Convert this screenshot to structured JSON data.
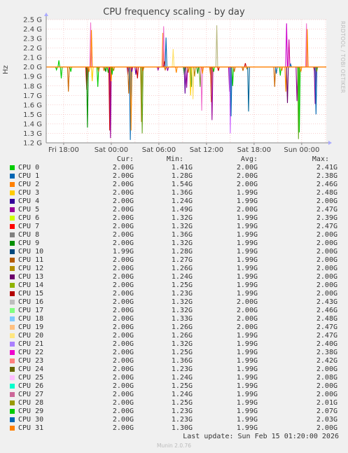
{
  "chart_data": {
    "type": "line",
    "title": "CPU frequency scaling - by day",
    "ylabel": "Hz",
    "ylim": [
      1.2,
      2.5
    ],
    "y_ticks": [
      "2.5 G",
      "2.4 G",
      "2.3 G",
      "2.2 G",
      "2.1 G",
      "2.0 G",
      "1.9 G",
      "1.8 G",
      "1.7 G",
      "1.6 G",
      "1.5 G",
      "1.4 G",
      "1.3 G",
      "1.2 G"
    ],
    "y_tick_values": [
      2.5,
      2.4,
      2.3,
      2.2,
      2.1,
      2.0,
      1.9,
      1.8,
      1.7,
      1.6,
      1.5,
      1.4,
      1.3,
      1.2
    ],
    "x_ticks": [
      "Fri 18:00",
      "Sat 00:00",
      "Sat 06:00",
      "Sat 12:00",
      "Sat 18:00",
      "Sun 00:00"
    ],
    "x_tick_hours": [
      0,
      6,
      12,
      18,
      24,
      30
    ],
    "x_range_hours": [
      -2.2,
      33.1
    ],
    "baseline": 2.0,
    "grid": true,
    "spikes": [
      {
        "t": -0.9,
        "v": 1.97,
        "c": "#00cc00"
      },
      {
        "t": -0.6,
        "v": 2.07,
        "c": "#00cc00"
      },
      {
        "t": -0.3,
        "v": 1.88,
        "c": "#00cc00"
      },
      {
        "t": 0.6,
        "v": 1.74,
        "c": "#cc6600"
      },
      {
        "t": 0.9,
        "v": 1.95,
        "c": "#00cc00"
      },
      {
        "t": 2.9,
        "v": 1.76,
        "c": "#cc0000"
      },
      {
        "t": 3.0,
        "v": 1.36,
        "c": "#008f00"
      },
      {
        "t": 3.2,
        "v": 1.95,
        "c": "#ff8800"
      },
      {
        "t": 3.4,
        "v": 2.47,
        "c": "#f06fcd"
      },
      {
        "t": 3.5,
        "v": 2.39,
        "c": "#ff8800"
      },
      {
        "t": 3.6,
        "v": 1.85,
        "c": "#ffcc00"
      },
      {
        "t": 4.3,
        "v": 1.79,
        "c": "#00cc00"
      },
      {
        "t": 4.4,
        "v": 1.95,
        "c": "#b8860b"
      },
      {
        "t": 5.1,
        "v": 1.96,
        "c": "#cc6600"
      },
      {
        "t": 5.3,
        "v": 1.95,
        "c": "#008f00"
      },
      {
        "t": 5.6,
        "v": 1.94,
        "c": "#00cc00"
      },
      {
        "t": 5.8,
        "v": 1.33,
        "c": "#cc0000"
      },
      {
        "t": 5.9,
        "v": 1.25,
        "c": "#990099"
      },
      {
        "t": 6.0,
        "v": 1.85,
        "c": "#ff8800"
      },
      {
        "t": 6.1,
        "v": 1.92,
        "c": "#00cc00"
      },
      {
        "t": 6.3,
        "v": 1.96,
        "c": "#b8860b"
      },
      {
        "t": 8.1,
        "v": 1.92,
        "c": "#990099"
      },
      {
        "t": 8.2,
        "v": 1.72,
        "c": "#cc6600"
      },
      {
        "t": 8.4,
        "v": 1.23,
        "c": "#0066b3"
      },
      {
        "t": 8.5,
        "v": 1.33,
        "c": "#ff8800"
      },
      {
        "t": 8.6,
        "v": 1.95,
        "c": "#990099"
      },
      {
        "t": 9.1,
        "v": 1.92,
        "c": "#660099"
      },
      {
        "t": 9.3,
        "v": 1.88,
        "c": "#cc0000"
      },
      {
        "t": 9.8,
        "v": 1.42,
        "c": "#b8860b"
      },
      {
        "t": 9.9,
        "v": 1.3,
        "c": "#66a61e"
      },
      {
        "t": 10.0,
        "v": 1.96,
        "c": "#cc6600"
      },
      {
        "t": 11.9,
        "v": 1.97,
        "c": "#990099"
      },
      {
        "t": 12.5,
        "v": 2.36,
        "c": "#ff8800"
      },
      {
        "t": 12.6,
        "v": 2.43,
        "c": "#f06fcd"
      },
      {
        "t": 12.7,
        "v": 2.06,
        "c": "#cc0000"
      },
      {
        "t": 12.8,
        "v": 1.97,
        "c": "#cc6600"
      },
      {
        "t": 12.9,
        "v": 2.31,
        "c": "#0066b3"
      },
      {
        "t": 13.1,
        "v": 1.96,
        "c": "#990099"
      },
      {
        "t": 13.8,
        "v": 2.19,
        "c": "#ffe066"
      },
      {
        "t": 14.2,
        "v": 1.94,
        "c": "#ff8800"
      },
      {
        "t": 15.2,
        "v": 1.92,
        "c": "#00cc00"
      },
      {
        "t": 15.3,
        "v": 1.72,
        "c": "#660099"
      },
      {
        "t": 15.5,
        "v": 1.78,
        "c": "#990099"
      },
      {
        "t": 15.7,
        "v": 1.94,
        "c": "#cc6600"
      },
      {
        "t": 16.0,
        "v": 1.7,
        "c": "#ffcc00"
      },
      {
        "t": 16.1,
        "v": 1.79,
        "c": "#66a61e"
      },
      {
        "t": 16.3,
        "v": 1.66,
        "c": "#ffe066"
      },
      {
        "t": 16.5,
        "v": 1.9,
        "c": "#b8860b"
      },
      {
        "t": 16.9,
        "v": 1.93,
        "c": "#008f00"
      },
      {
        "t": 17.2,
        "v": 1.79,
        "c": "#66a61e"
      },
      {
        "t": 17.4,
        "v": 1.54,
        "c": "#f06fcd"
      },
      {
        "t": 17.5,
        "v": 1.93,
        "c": "#ff8800"
      },
      {
        "t": 18.5,
        "v": 1.92,
        "c": "#cc6600"
      },
      {
        "t": 18.6,
        "v": 1.63,
        "c": "#ff8800"
      },
      {
        "t": 18.7,
        "v": 1.44,
        "c": "#990099"
      },
      {
        "t": 18.9,
        "v": 1.95,
        "c": "#00cc00"
      },
      {
        "t": 19.3,
        "v": 2.44,
        "c": "#b8b880"
      },
      {
        "t": 19.5,
        "v": 1.96,
        "c": "#cc0000"
      },
      {
        "t": 20.9,
        "v": 1.74,
        "c": "#990099"
      },
      {
        "t": 21.0,
        "v": 1.3,
        "c": "#cc66ff"
      },
      {
        "t": 21.1,
        "v": 1.48,
        "c": "#0066b3"
      },
      {
        "t": 21.3,
        "v": 1.8,
        "c": "#00cc00"
      },
      {
        "t": 21.5,
        "v": 1.95,
        "c": "#cc6600"
      },
      {
        "t": 22.6,
        "v": 1.96,
        "c": "#cc6600"
      },
      {
        "t": 22.9,
        "v": 2.04,
        "c": "#cc0000"
      },
      {
        "t": 23.1,
        "v": 1.98,
        "c": "#b8860b"
      },
      {
        "t": 23.3,
        "v": 1.53,
        "c": "#006699"
      },
      {
        "t": 26.6,
        "v": 1.79,
        "c": "#cc6600"
      },
      {
        "t": 26.8,
        "v": 1.93,
        "c": "#0066b3"
      },
      {
        "t": 27.3,
        "v": 1.91,
        "c": "#00cc00"
      },
      {
        "t": 27.5,
        "v": 1.96,
        "c": "#ff8800"
      },
      {
        "t": 28.0,
        "v": 1.74,
        "c": "#ff8800"
      },
      {
        "t": 28.1,
        "v": 2.46,
        "c": "#cc00cc"
      },
      {
        "t": 28.2,
        "v": 1.62,
        "c": "#660066"
      },
      {
        "t": 28.4,
        "v": 2.29,
        "c": "#cc0099"
      },
      {
        "t": 28.6,
        "v": 2.03,
        "c": "#0066b3"
      },
      {
        "t": 29.4,
        "v": 1.64,
        "c": "#990099"
      },
      {
        "t": 29.6,
        "v": 1.24,
        "c": "#66a61e"
      },
      {
        "t": 29.7,
        "v": 1.31,
        "c": "#00cc00"
      },
      {
        "t": 29.9,
        "v": 1.95,
        "c": "#ff8800"
      },
      {
        "t": 30.6,
        "v": 2.46,
        "c": "#f06fcd"
      },
      {
        "t": 30.7,
        "v": 2.4,
        "c": "#ff8800"
      },
      {
        "t": 31.6,
        "v": 1.96,
        "c": "#cc6600"
      },
      {
        "t": 31.7,
        "v": 1.61,
        "c": "#990099"
      },
      {
        "t": 31.8,
        "v": 1.5,
        "c": "#0066b3"
      },
      {
        "t": 31.9,
        "v": 1.95,
        "c": "#66a61e"
      }
    ]
  },
  "side_label": "RRDTOOL / TOBI OETIKER",
  "legend": {
    "headers": {
      "cur": "Cur:",
      "min": "Min:",
      "avg": "Avg:",
      "max": "Max:"
    },
    "rows": [
      {
        "name": "CPU 0",
        "color": "#00cc00",
        "cur": "2.00G",
        "min": "1.41G",
        "avg": "2.00G",
        "max": "2.41G"
      },
      {
        "name": "CPU 1",
        "color": "#0066b3",
        "cur": "2.00G",
        "min": "1.28G",
        "avg": "2.00G",
        "max": "2.38G"
      },
      {
        "name": "CPU 2",
        "color": "#ff8000",
        "cur": "2.00G",
        "min": "1.54G",
        "avg": "2.00G",
        "max": "2.46G"
      },
      {
        "name": "CPU 3",
        "color": "#ffcc00",
        "cur": "2.00G",
        "min": "1.36G",
        "avg": "1.99G",
        "max": "2.48G"
      },
      {
        "name": "CPU 4",
        "color": "#330099",
        "cur": "2.00G",
        "min": "1.24G",
        "avg": "1.99G",
        "max": "2.00G"
      },
      {
        "name": "CPU 5",
        "color": "#990099",
        "cur": "2.00G",
        "min": "1.49G",
        "avg": "2.00G",
        "max": "2.47G"
      },
      {
        "name": "CPU 6",
        "color": "#ccff00",
        "cur": "2.00G",
        "min": "1.32G",
        "avg": "1.99G",
        "max": "2.39G"
      },
      {
        "name": "CPU 7",
        "color": "#ff0000",
        "cur": "2.00G",
        "min": "1.32G",
        "avg": "1.99G",
        "max": "2.47G"
      },
      {
        "name": "CPU 8",
        "color": "#808080",
        "cur": "2.00G",
        "min": "1.36G",
        "avg": "1.99G",
        "max": "2.00G"
      },
      {
        "name": "CPU 9",
        "color": "#008f00",
        "cur": "2.00G",
        "min": "1.32G",
        "avg": "1.99G",
        "max": "2.00G"
      },
      {
        "name": "CPU 10",
        "color": "#00487d",
        "cur": "1.99G",
        "min": "1.28G",
        "avg": "1.99G",
        "max": "2.00G"
      },
      {
        "name": "CPU 11",
        "color": "#b35a00",
        "cur": "2.00G",
        "min": "1.27G",
        "avg": "1.99G",
        "max": "2.00G"
      },
      {
        "name": "CPU 12",
        "color": "#b38f00",
        "cur": "2.00G",
        "min": "1.26G",
        "avg": "1.99G",
        "max": "2.00G"
      },
      {
        "name": "CPU 13",
        "color": "#6b006b",
        "cur": "2.00G",
        "min": "1.24G",
        "avg": "1.99G",
        "max": "2.00G"
      },
      {
        "name": "CPU 14",
        "color": "#8fb300",
        "cur": "2.00G",
        "min": "1.25G",
        "avg": "1.99G",
        "max": "2.00G"
      },
      {
        "name": "CPU 15",
        "color": "#b30000",
        "cur": "2.00G",
        "min": "1.23G",
        "avg": "1.99G",
        "max": "2.00G"
      },
      {
        "name": "CPU 16",
        "color": "#bebebe",
        "cur": "2.00G",
        "min": "1.32G",
        "avg": "2.00G",
        "max": "2.43G"
      },
      {
        "name": "CPU 17",
        "color": "#80ff80",
        "cur": "2.00G",
        "min": "1.32G",
        "avg": "2.00G",
        "max": "2.46G"
      },
      {
        "name": "CPU 18",
        "color": "#80c9ff",
        "cur": "2.00G",
        "min": "1.33G",
        "avg": "2.00G",
        "max": "2.48G"
      },
      {
        "name": "CPU 19",
        "color": "#ffc080",
        "cur": "2.00G",
        "min": "1.26G",
        "avg": "2.00G",
        "max": "2.47G"
      },
      {
        "name": "CPU 20",
        "color": "#ffe680",
        "cur": "2.00G",
        "min": "1.26G",
        "avg": "1.99G",
        "max": "2.47G"
      },
      {
        "name": "CPU 21",
        "color": "#aa80ff",
        "cur": "2.00G",
        "min": "1.32G",
        "avg": "1.99G",
        "max": "2.40G"
      },
      {
        "name": "CPU 22",
        "color": "#ee00cc",
        "cur": "2.00G",
        "min": "1.25G",
        "avg": "1.99G",
        "max": "2.38G"
      },
      {
        "name": "CPU 23",
        "color": "#ff8080",
        "cur": "2.00G",
        "min": "1.36G",
        "avg": "1.99G",
        "max": "2.42G"
      },
      {
        "name": "CPU 24",
        "color": "#666600",
        "cur": "2.00G",
        "min": "1.23G",
        "avg": "1.99G",
        "max": "2.00G"
      },
      {
        "name": "CPU 25",
        "color": "#ffbfff",
        "cur": "2.00G",
        "min": "1.24G",
        "avg": "1.99G",
        "max": "2.08G"
      },
      {
        "name": "CPU 26",
        "color": "#00ffcc",
        "cur": "2.00G",
        "min": "1.25G",
        "avg": "1.99G",
        "max": "2.00G"
      },
      {
        "name": "CPU 27",
        "color": "#cc6699",
        "cur": "2.00G",
        "min": "1.24G",
        "avg": "1.99G",
        "max": "2.00G"
      },
      {
        "name": "CPU 28",
        "color": "#999900",
        "cur": "2.00G",
        "min": "1.25G",
        "avg": "1.99G",
        "max": "2.01G"
      },
      {
        "name": "CPU 29",
        "color": "#00cc00",
        "cur": "2.00G",
        "min": "1.23G",
        "avg": "1.99G",
        "max": "2.07G"
      },
      {
        "name": "CPU 30",
        "color": "#0066b3",
        "cur": "2.00G",
        "min": "1.23G",
        "avg": "1.99G",
        "max": "2.03G"
      },
      {
        "name": "CPU 31",
        "color": "#ff8000",
        "cur": "2.00G",
        "min": "1.30G",
        "avg": "1.99G",
        "max": "2.00G"
      }
    ]
  },
  "footer": {
    "last_update": "Last update: Sun Feb 15 01:20:00 2026",
    "version": "Munin 2.0.76"
  },
  "colors": {
    "background": "#f0f0f0",
    "plot_bg": "#ffffff",
    "grid": "#f0a0a0",
    "axis": "#888888",
    "baseline": "#ff8000"
  }
}
